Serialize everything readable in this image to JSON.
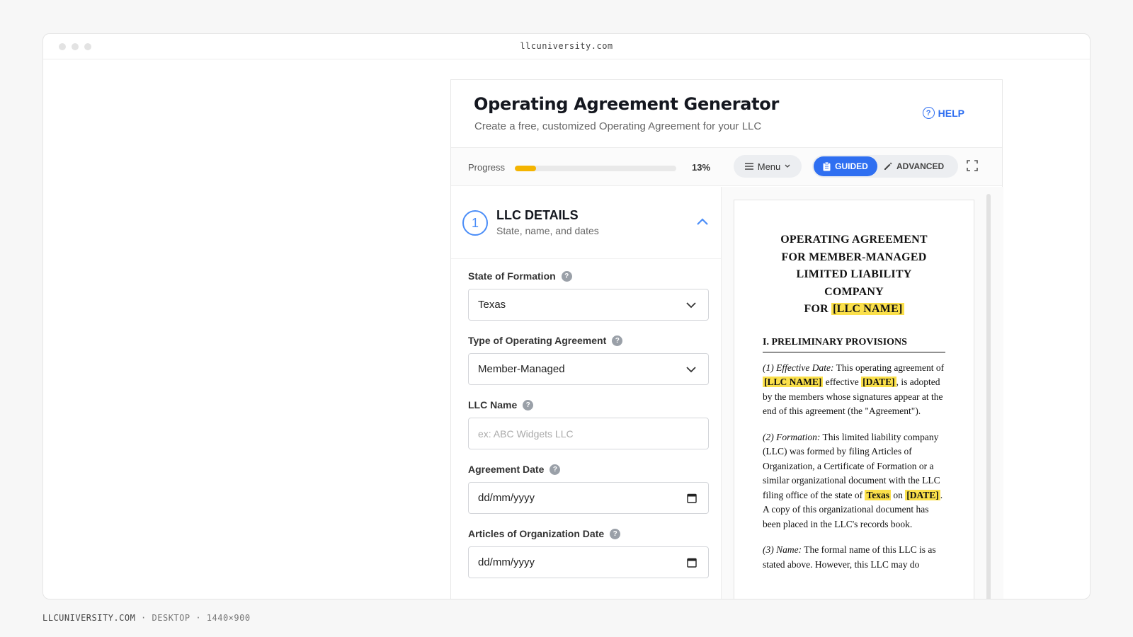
{
  "browser": {
    "url": "llcuniversity.com"
  },
  "caption": {
    "site": "LLCUNIVERSITY.COM",
    "sep1": " · ",
    "device": "DESKTOP",
    "sep2": " · ",
    "size": "1440×900"
  },
  "header": {
    "title": "Operating Agreement Generator",
    "subtitle": "Create a free, customized Operating Agreement for your LLC",
    "help_label": "HELP",
    "help_glyph": "?"
  },
  "toolbar": {
    "progress_label": "Progress",
    "progress_value": 0.13,
    "progress_text": "13%",
    "menu_label": "Menu",
    "mode_guided": "GUIDED",
    "mode_advanced": "ADVANCED",
    "active_mode": "guided"
  },
  "section": {
    "number": "1",
    "title": "LLC DETAILS",
    "subtitle": "State, name, and dates",
    "expanded": true
  },
  "fields": [
    {
      "label": "State of Formation",
      "help": "?",
      "type": "select",
      "value": "Texas"
    },
    {
      "label": "Type of Operating Agreement",
      "help": "?",
      "type": "select",
      "value": "Member-Managed"
    },
    {
      "label": "LLC Name",
      "help": "?",
      "type": "text",
      "value": "",
      "placeholder": "ex: ABC Widgets LLC"
    },
    {
      "label": "Agreement Date",
      "help": "?",
      "type": "date",
      "value": "dd/mm/yyyy"
    },
    {
      "label": "Articles of Organization Date",
      "help": "?",
      "type": "date",
      "value": "dd/mm/yyyy"
    }
  ],
  "document": {
    "title_lines": [
      "OPERATING AGREEMENT",
      "FOR MEMBER-MANAGED",
      "LIMITED LIABILITY",
      "COMPANY"
    ],
    "title_for": "FOR ",
    "llc_placeholder": "[LLC NAME]",
    "date_placeholder": "[DATE]",
    "state_value": "Texas",
    "section_heading": "I. PRELIMINARY PROVISIONS",
    "p1": {
      "label": "(1) Effective Date:",
      "text_a": " This operating agreement of ",
      "text_b": " effective ",
      "text_c": ", is adopted by the members whose signatures appear at the end of this agreement (the \"Agreement\")."
    },
    "p2": {
      "label": "(2) Formation:",
      "text_a": " This limited liability company (LLC) was formed by filing Articles of Organization, a Certificate of Formation or a similar organizational document with the LLC filing office of the state of ",
      "text_b": " on ",
      "text_c": ". A copy of this organizational document has been placed in the LLC's records book."
    },
    "p3": {
      "label": "(3) Name:",
      "text_a": " The formal name of this LLC is as stated above. However, this LLC may do"
    }
  }
}
